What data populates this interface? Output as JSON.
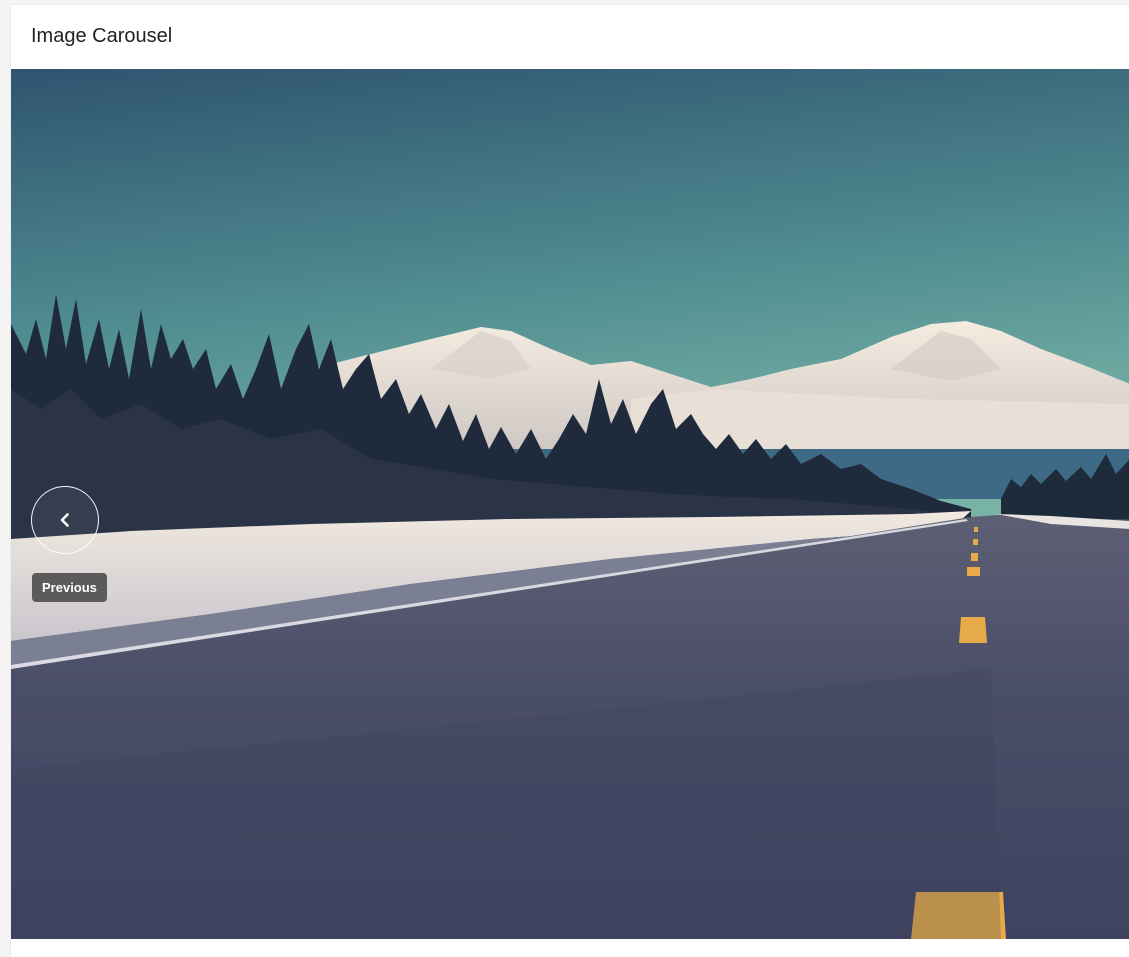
{
  "card": {
    "title": "Image Carousel"
  },
  "carousel": {
    "previous_icon": "chevron-left-icon",
    "previous_tooltip": "Previous"
  },
  "colors": {
    "sky_top": "#33576f",
    "sky_bottom": "#6aa59f",
    "road": "#4a4d67",
    "lane_marking": "#e6ab48",
    "snow": "#ece5dc",
    "tooltip_bg": "#505050"
  }
}
